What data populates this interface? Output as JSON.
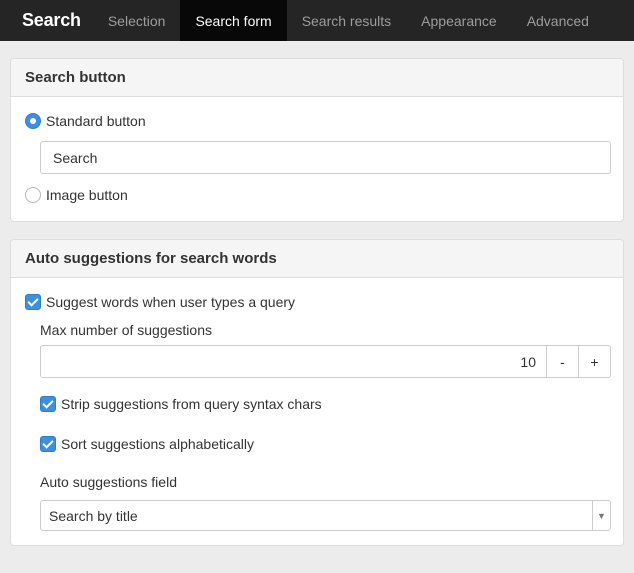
{
  "navbar": {
    "brand": "Search",
    "tabs": [
      {
        "label": "Selection",
        "active": false
      },
      {
        "label": "Search form",
        "active": true
      },
      {
        "label": "Search results",
        "active": false
      },
      {
        "label": "Appearance",
        "active": false
      },
      {
        "label": "Advanced",
        "active": false
      }
    ]
  },
  "search_button_panel": {
    "title": "Search button",
    "standard_option": {
      "label": "Standard button",
      "selected": true
    },
    "button_text": "Search",
    "image_option": {
      "label": "Image button",
      "selected": false
    }
  },
  "suggestions_panel": {
    "title": "Auto suggestions for search words",
    "suggest_words": {
      "label": "Suggest words when user types a query",
      "checked": true
    },
    "max_label": "Max number of suggestions",
    "max_value": "10",
    "decrement_label": "-",
    "increment_label": "+",
    "strip_syntax": {
      "label": "Strip suggestions from query syntax chars",
      "checked": true
    },
    "sort_alpha": {
      "label": "Sort suggestions alphabetically",
      "checked": true
    },
    "field_label": "Auto suggestions field",
    "field_value": "Search by title"
  },
  "colors": {
    "navbar_bg": "#252525",
    "active_tab_bg": "#080808",
    "accent": "#3d8fe0"
  }
}
